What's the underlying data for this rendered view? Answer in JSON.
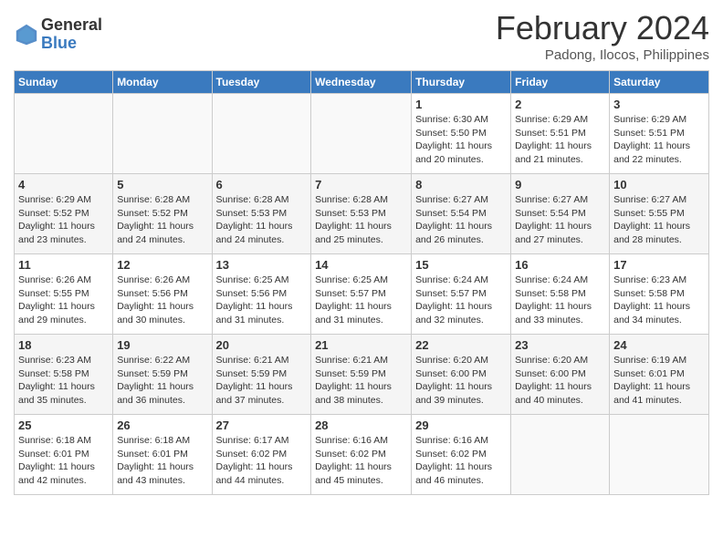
{
  "logo": {
    "general": "General",
    "blue": "Blue"
  },
  "title": "February 2024",
  "subtitle": "Padong, Ilocos, Philippines",
  "weekdays": [
    "Sunday",
    "Monday",
    "Tuesday",
    "Wednesday",
    "Thursday",
    "Friday",
    "Saturday"
  ],
  "weeks": [
    [
      {
        "day": "",
        "info": ""
      },
      {
        "day": "",
        "info": ""
      },
      {
        "day": "",
        "info": ""
      },
      {
        "day": "",
        "info": ""
      },
      {
        "day": "1",
        "info": "Sunrise: 6:30 AM\nSunset: 5:50 PM\nDaylight: 11 hours and 20 minutes."
      },
      {
        "day": "2",
        "info": "Sunrise: 6:29 AM\nSunset: 5:51 PM\nDaylight: 11 hours and 21 minutes."
      },
      {
        "day": "3",
        "info": "Sunrise: 6:29 AM\nSunset: 5:51 PM\nDaylight: 11 hours and 22 minutes."
      }
    ],
    [
      {
        "day": "4",
        "info": "Sunrise: 6:29 AM\nSunset: 5:52 PM\nDaylight: 11 hours and 23 minutes."
      },
      {
        "day": "5",
        "info": "Sunrise: 6:28 AM\nSunset: 5:52 PM\nDaylight: 11 hours and 24 minutes."
      },
      {
        "day": "6",
        "info": "Sunrise: 6:28 AM\nSunset: 5:53 PM\nDaylight: 11 hours and 24 minutes."
      },
      {
        "day": "7",
        "info": "Sunrise: 6:28 AM\nSunset: 5:53 PM\nDaylight: 11 hours and 25 minutes."
      },
      {
        "day": "8",
        "info": "Sunrise: 6:27 AM\nSunset: 5:54 PM\nDaylight: 11 hours and 26 minutes."
      },
      {
        "day": "9",
        "info": "Sunrise: 6:27 AM\nSunset: 5:54 PM\nDaylight: 11 hours and 27 minutes."
      },
      {
        "day": "10",
        "info": "Sunrise: 6:27 AM\nSunset: 5:55 PM\nDaylight: 11 hours and 28 minutes."
      }
    ],
    [
      {
        "day": "11",
        "info": "Sunrise: 6:26 AM\nSunset: 5:55 PM\nDaylight: 11 hours and 29 minutes."
      },
      {
        "day": "12",
        "info": "Sunrise: 6:26 AM\nSunset: 5:56 PM\nDaylight: 11 hours and 30 minutes."
      },
      {
        "day": "13",
        "info": "Sunrise: 6:25 AM\nSunset: 5:56 PM\nDaylight: 11 hours and 31 minutes."
      },
      {
        "day": "14",
        "info": "Sunrise: 6:25 AM\nSunset: 5:57 PM\nDaylight: 11 hours and 31 minutes."
      },
      {
        "day": "15",
        "info": "Sunrise: 6:24 AM\nSunset: 5:57 PM\nDaylight: 11 hours and 32 minutes."
      },
      {
        "day": "16",
        "info": "Sunrise: 6:24 AM\nSunset: 5:58 PM\nDaylight: 11 hours and 33 minutes."
      },
      {
        "day": "17",
        "info": "Sunrise: 6:23 AM\nSunset: 5:58 PM\nDaylight: 11 hours and 34 minutes."
      }
    ],
    [
      {
        "day": "18",
        "info": "Sunrise: 6:23 AM\nSunset: 5:58 PM\nDaylight: 11 hours and 35 minutes."
      },
      {
        "day": "19",
        "info": "Sunrise: 6:22 AM\nSunset: 5:59 PM\nDaylight: 11 hours and 36 minutes."
      },
      {
        "day": "20",
        "info": "Sunrise: 6:21 AM\nSunset: 5:59 PM\nDaylight: 11 hours and 37 minutes."
      },
      {
        "day": "21",
        "info": "Sunrise: 6:21 AM\nSunset: 5:59 PM\nDaylight: 11 hours and 38 minutes."
      },
      {
        "day": "22",
        "info": "Sunrise: 6:20 AM\nSunset: 6:00 PM\nDaylight: 11 hours and 39 minutes."
      },
      {
        "day": "23",
        "info": "Sunrise: 6:20 AM\nSunset: 6:00 PM\nDaylight: 11 hours and 40 minutes."
      },
      {
        "day": "24",
        "info": "Sunrise: 6:19 AM\nSunset: 6:01 PM\nDaylight: 11 hours and 41 minutes."
      }
    ],
    [
      {
        "day": "25",
        "info": "Sunrise: 6:18 AM\nSunset: 6:01 PM\nDaylight: 11 hours and 42 minutes."
      },
      {
        "day": "26",
        "info": "Sunrise: 6:18 AM\nSunset: 6:01 PM\nDaylight: 11 hours and 43 minutes."
      },
      {
        "day": "27",
        "info": "Sunrise: 6:17 AM\nSunset: 6:02 PM\nDaylight: 11 hours and 44 minutes."
      },
      {
        "day": "28",
        "info": "Sunrise: 6:16 AM\nSunset: 6:02 PM\nDaylight: 11 hours and 45 minutes."
      },
      {
        "day": "29",
        "info": "Sunrise: 6:16 AM\nSunset: 6:02 PM\nDaylight: 11 hours and 46 minutes."
      },
      {
        "day": "",
        "info": ""
      },
      {
        "day": "",
        "info": ""
      }
    ]
  ]
}
